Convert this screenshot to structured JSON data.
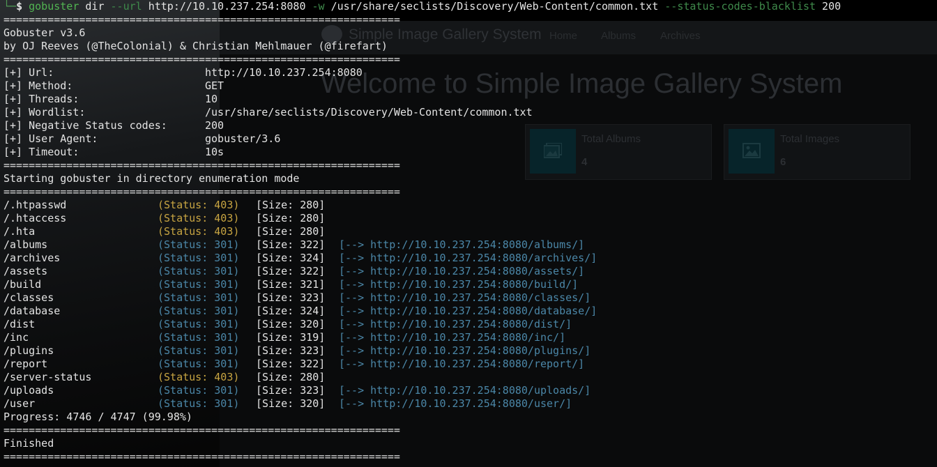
{
  "background_page": {
    "brand": "Simple Image Gallery System",
    "nav": [
      "Home",
      "Albums",
      "Archives"
    ],
    "welcome": "Welcome to Simple Image Gallery System",
    "cards": [
      {
        "title": "Total Albums",
        "value": "4",
        "icon": "images-icon"
      },
      {
        "title": "Total Images",
        "value": "6",
        "icon": "image-icon"
      }
    ]
  },
  "terminal": {
    "prompt": {
      "corner": "└─",
      "symbol": "$"
    },
    "command": {
      "name": "gobuster",
      "mode": "dir",
      "url_flag": "--url",
      "url": "http://10.10.237.254:8080",
      "wordlist_flag": "-w",
      "wordlist": "/usr/share/seclists/Discovery/Web-Content/common.txt",
      "blacklist_flag": "--status-codes-blacklist",
      "blacklist": "200"
    },
    "separator": "===============================================================",
    "banner": [
      "Gobuster v3.6",
      "by OJ Reeves (@TheColonial) & Christian Mehlmauer (@firefart)"
    ],
    "config": [
      {
        "key": "[+] Url:",
        "value": "http://10.10.237.254:8080"
      },
      {
        "key": "[+] Method:",
        "value": "GET"
      },
      {
        "key": "[+] Threads:",
        "value": "10"
      },
      {
        "key": "[+] Wordlist:",
        "value": "/usr/share/seclists/Discovery/Web-Content/common.txt"
      },
      {
        "key": "[+] Negative Status codes:",
        "value": "200"
      },
      {
        "key": "[+] User Agent:",
        "value": "gobuster/3.6"
      },
      {
        "key": "[+] Timeout:",
        "value": "10s"
      }
    ],
    "start_message": "Starting gobuster in directory enumeration mode",
    "results": [
      {
        "path": "/.htpasswd",
        "status": "(Status: 403)",
        "code": 403,
        "size": "[Size: 280]",
        "redirect": ""
      },
      {
        "path": "/.htaccess",
        "status": "(Status: 403)",
        "code": 403,
        "size": "[Size: 280]",
        "redirect": ""
      },
      {
        "path": "/.hta",
        "status": "(Status: 403)",
        "code": 403,
        "size": "[Size: 280]",
        "redirect": ""
      },
      {
        "path": "/albums",
        "status": "(Status: 301)",
        "code": 301,
        "size": "[Size: 322]",
        "redirect": "[--> http://10.10.237.254:8080/albums/]"
      },
      {
        "path": "/archives",
        "status": "(Status: 301)",
        "code": 301,
        "size": "[Size: 324]",
        "redirect": "[--> http://10.10.237.254:8080/archives/]"
      },
      {
        "path": "/assets",
        "status": "(Status: 301)",
        "code": 301,
        "size": "[Size: 322]",
        "redirect": "[--> http://10.10.237.254:8080/assets/]"
      },
      {
        "path": "/build",
        "status": "(Status: 301)",
        "code": 301,
        "size": "[Size: 321]",
        "redirect": "[--> http://10.10.237.254:8080/build/]"
      },
      {
        "path": "/classes",
        "status": "(Status: 301)",
        "code": 301,
        "size": "[Size: 323]",
        "redirect": "[--> http://10.10.237.254:8080/classes/]"
      },
      {
        "path": "/database",
        "status": "(Status: 301)",
        "code": 301,
        "size": "[Size: 324]",
        "redirect": "[--> http://10.10.237.254:8080/database/]"
      },
      {
        "path": "/dist",
        "status": "(Status: 301)",
        "code": 301,
        "size": "[Size: 320]",
        "redirect": "[--> http://10.10.237.254:8080/dist/]"
      },
      {
        "path": "/inc",
        "status": "(Status: 301)",
        "code": 301,
        "size": "[Size: 319]",
        "redirect": "[--> http://10.10.237.254:8080/inc/]"
      },
      {
        "path": "/plugins",
        "status": "(Status: 301)",
        "code": 301,
        "size": "[Size: 323]",
        "redirect": "[--> http://10.10.237.254:8080/plugins/]"
      },
      {
        "path": "/report",
        "status": "(Status: 301)",
        "code": 301,
        "size": "[Size: 322]",
        "redirect": "[--> http://10.10.237.254:8080/report/]"
      },
      {
        "path": "/server-status",
        "status": "(Status: 403)",
        "code": 403,
        "size": "[Size: 280]",
        "redirect": ""
      },
      {
        "path": "/uploads",
        "status": "(Status: 301)",
        "code": 301,
        "size": "[Size: 323]",
        "redirect": "[--> http://10.10.237.254:8080/uploads/]"
      },
      {
        "path": "/user",
        "status": "(Status: 301)",
        "code": 301,
        "size": "[Size: 320]",
        "redirect": "[--> http://10.10.237.254:8080/user/]"
      }
    ],
    "progress": "Progress: 4746 / 4747 (99.98%)",
    "finished": "Finished",
    "colors": {
      "status_403": "#c8a542",
      "status_301": "#4b87a8",
      "command": "#52b552",
      "flag": "#3f8a4b"
    }
  }
}
